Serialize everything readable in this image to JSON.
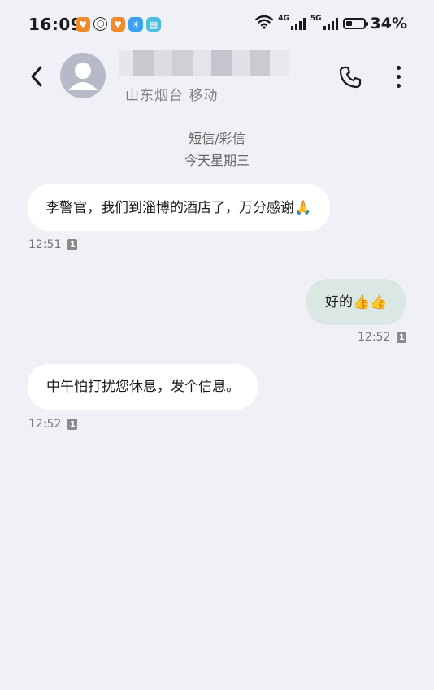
{
  "status_bar": {
    "time": "16:09",
    "app_icons": [
      {
        "name": "heart-app-icon",
        "glyph": "♥",
        "color": "#f08a2b"
      },
      {
        "name": "shield-app-icon",
        "glyph": "⬡",
        "color": "#2c2c2c"
      },
      {
        "name": "heart-app-icon-2",
        "glyph": "♥",
        "color": "#f08a2b"
      },
      {
        "name": "weather-app-icon",
        "glyph": "☀",
        "color": "#3aa0f0"
      },
      {
        "name": "book-app-icon",
        "glyph": "▤",
        "color": "#4cbfe0"
      }
    ],
    "network1": "4G",
    "network2": "5G",
    "battery_percent": "34%",
    "battery_level": 0.34
  },
  "header": {
    "contact_subtitle": "山东烟台 移动"
  },
  "thread": {
    "sms_label": "短信/彩信",
    "day_label": "今天星期三",
    "messages": [
      {
        "direction": "in",
        "text": "李警官，我们到淄博的酒店了，万分感谢🙏",
        "time": "12:51",
        "sim": "1"
      },
      {
        "direction": "out",
        "text": "好的👍👍",
        "time": "12:52",
        "sim": "1"
      },
      {
        "direction": "in",
        "text": "中午怕打扰您休息，发个信息。",
        "time": "12:52",
        "sim": "1"
      }
    ]
  },
  "colors": {
    "background": "#f0f1f6",
    "incoming_bubble": "#ffffff",
    "outgoing_bubble": "#dbe7e2"
  }
}
